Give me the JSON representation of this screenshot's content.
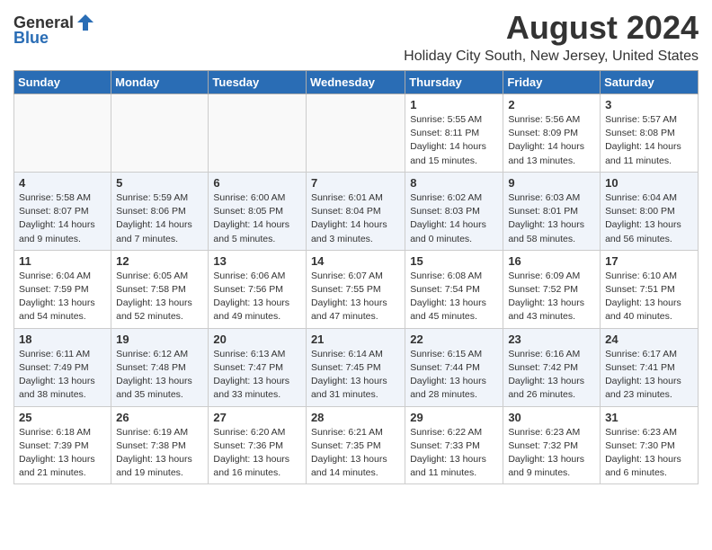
{
  "header": {
    "logo_general": "General",
    "logo_blue": "Blue",
    "month_year": "August 2024",
    "location": "Holiday City South, New Jersey, United States"
  },
  "weekdays": [
    "Sunday",
    "Monday",
    "Tuesday",
    "Wednesday",
    "Thursday",
    "Friday",
    "Saturday"
  ],
  "weeks": [
    [
      {
        "day": "",
        "info": ""
      },
      {
        "day": "",
        "info": ""
      },
      {
        "day": "",
        "info": ""
      },
      {
        "day": "",
        "info": ""
      },
      {
        "day": "1",
        "info": "Sunrise: 5:55 AM\nSunset: 8:11 PM\nDaylight: 14 hours\nand 15 minutes."
      },
      {
        "day": "2",
        "info": "Sunrise: 5:56 AM\nSunset: 8:09 PM\nDaylight: 14 hours\nand 13 minutes."
      },
      {
        "day": "3",
        "info": "Sunrise: 5:57 AM\nSunset: 8:08 PM\nDaylight: 14 hours\nand 11 minutes."
      }
    ],
    [
      {
        "day": "4",
        "info": "Sunrise: 5:58 AM\nSunset: 8:07 PM\nDaylight: 14 hours\nand 9 minutes."
      },
      {
        "day": "5",
        "info": "Sunrise: 5:59 AM\nSunset: 8:06 PM\nDaylight: 14 hours\nand 7 minutes."
      },
      {
        "day": "6",
        "info": "Sunrise: 6:00 AM\nSunset: 8:05 PM\nDaylight: 14 hours\nand 5 minutes."
      },
      {
        "day": "7",
        "info": "Sunrise: 6:01 AM\nSunset: 8:04 PM\nDaylight: 14 hours\nand 3 minutes."
      },
      {
        "day": "8",
        "info": "Sunrise: 6:02 AM\nSunset: 8:03 PM\nDaylight: 14 hours\nand 0 minutes."
      },
      {
        "day": "9",
        "info": "Sunrise: 6:03 AM\nSunset: 8:01 PM\nDaylight: 13 hours\nand 58 minutes."
      },
      {
        "day": "10",
        "info": "Sunrise: 6:04 AM\nSunset: 8:00 PM\nDaylight: 13 hours\nand 56 minutes."
      }
    ],
    [
      {
        "day": "11",
        "info": "Sunrise: 6:04 AM\nSunset: 7:59 PM\nDaylight: 13 hours\nand 54 minutes."
      },
      {
        "day": "12",
        "info": "Sunrise: 6:05 AM\nSunset: 7:58 PM\nDaylight: 13 hours\nand 52 minutes."
      },
      {
        "day": "13",
        "info": "Sunrise: 6:06 AM\nSunset: 7:56 PM\nDaylight: 13 hours\nand 49 minutes."
      },
      {
        "day": "14",
        "info": "Sunrise: 6:07 AM\nSunset: 7:55 PM\nDaylight: 13 hours\nand 47 minutes."
      },
      {
        "day": "15",
        "info": "Sunrise: 6:08 AM\nSunset: 7:54 PM\nDaylight: 13 hours\nand 45 minutes."
      },
      {
        "day": "16",
        "info": "Sunrise: 6:09 AM\nSunset: 7:52 PM\nDaylight: 13 hours\nand 43 minutes."
      },
      {
        "day": "17",
        "info": "Sunrise: 6:10 AM\nSunset: 7:51 PM\nDaylight: 13 hours\nand 40 minutes."
      }
    ],
    [
      {
        "day": "18",
        "info": "Sunrise: 6:11 AM\nSunset: 7:49 PM\nDaylight: 13 hours\nand 38 minutes."
      },
      {
        "day": "19",
        "info": "Sunrise: 6:12 AM\nSunset: 7:48 PM\nDaylight: 13 hours\nand 35 minutes."
      },
      {
        "day": "20",
        "info": "Sunrise: 6:13 AM\nSunset: 7:47 PM\nDaylight: 13 hours\nand 33 minutes."
      },
      {
        "day": "21",
        "info": "Sunrise: 6:14 AM\nSunset: 7:45 PM\nDaylight: 13 hours\nand 31 minutes."
      },
      {
        "day": "22",
        "info": "Sunrise: 6:15 AM\nSunset: 7:44 PM\nDaylight: 13 hours\nand 28 minutes."
      },
      {
        "day": "23",
        "info": "Sunrise: 6:16 AM\nSunset: 7:42 PM\nDaylight: 13 hours\nand 26 minutes."
      },
      {
        "day": "24",
        "info": "Sunrise: 6:17 AM\nSunset: 7:41 PM\nDaylight: 13 hours\nand 23 minutes."
      }
    ],
    [
      {
        "day": "25",
        "info": "Sunrise: 6:18 AM\nSunset: 7:39 PM\nDaylight: 13 hours\nand 21 minutes."
      },
      {
        "day": "26",
        "info": "Sunrise: 6:19 AM\nSunset: 7:38 PM\nDaylight: 13 hours\nand 19 minutes."
      },
      {
        "day": "27",
        "info": "Sunrise: 6:20 AM\nSunset: 7:36 PM\nDaylight: 13 hours\nand 16 minutes."
      },
      {
        "day": "28",
        "info": "Sunrise: 6:21 AM\nSunset: 7:35 PM\nDaylight: 13 hours\nand 14 minutes."
      },
      {
        "day": "29",
        "info": "Sunrise: 6:22 AM\nSunset: 7:33 PM\nDaylight: 13 hours\nand 11 minutes."
      },
      {
        "day": "30",
        "info": "Sunrise: 6:23 AM\nSunset: 7:32 PM\nDaylight: 13 hours\nand 9 minutes."
      },
      {
        "day": "31",
        "info": "Sunrise: 6:23 AM\nSunset: 7:30 PM\nDaylight: 13 hours\nand 6 minutes."
      }
    ]
  ]
}
